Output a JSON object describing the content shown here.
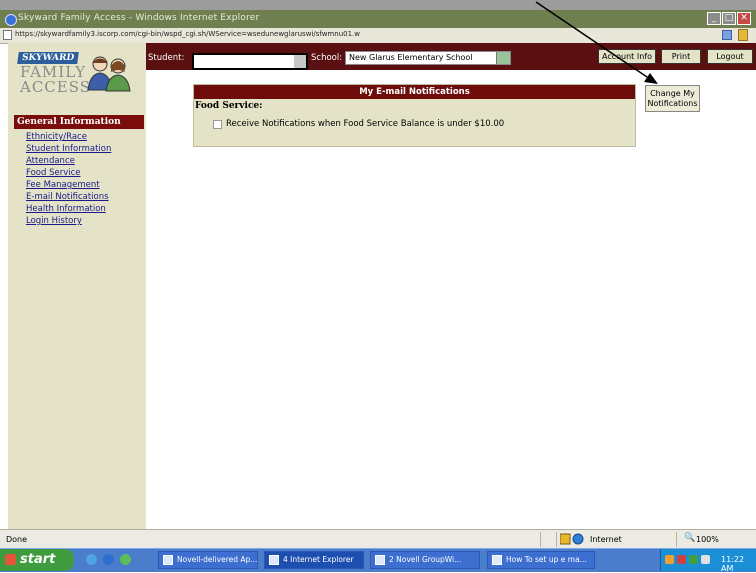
{
  "window": {
    "title": "Skyward Family Access - Windows Internet Explorer",
    "url": "https://skywardfamily3.iscorp.com/cgi-bin/wspd_cgi.sh/WService=wsedunewglaruswi/sfwmnu01.w"
  },
  "header": {
    "student_label": "Student:",
    "student_value": "",
    "school_label": "School:",
    "school_value": "New Glarus Elementary School",
    "account_info": "Account Info",
    "print": "Print",
    "logout": "Logout"
  },
  "logo": {
    "brand": "SKYWARD",
    "line1": "FAMILY",
    "line2": "ACCESS"
  },
  "sidebar": {
    "heading": "General Information",
    "items": [
      {
        "label": "Ethnicity/Race"
      },
      {
        "label": "Student Information"
      },
      {
        "label": "Attendance"
      },
      {
        "label": "Food Service"
      },
      {
        "label": "Fee Management"
      },
      {
        "label": "E-mail Notifications"
      },
      {
        "label": "Health Information"
      },
      {
        "label": "Login History"
      }
    ]
  },
  "main": {
    "panel_title": "My E-mail Notifications",
    "section_title": "Food Service:",
    "option_label": "Receive Notifications when Food Service Balance is under $10.00",
    "option_checked": false,
    "change_button": "Change My Notifications"
  },
  "statusbar": {
    "status": "Done",
    "zone": "Internet",
    "zoom": "100%"
  },
  "taskbar": {
    "start": "start",
    "tasks": [
      {
        "label": "Novell-delivered Ap..."
      },
      {
        "label": "4 Internet Explorer"
      },
      {
        "label": "2 Novell GroupWi..."
      },
      {
        "label": "How To set up e ma..."
      }
    ],
    "clock": "11:22 AM"
  },
  "colors": {
    "maroon": "#6e0c0c",
    "tan": "#e4e3c7",
    "link": "#1a1a8a",
    "taskbar": "#4a7dcc"
  }
}
